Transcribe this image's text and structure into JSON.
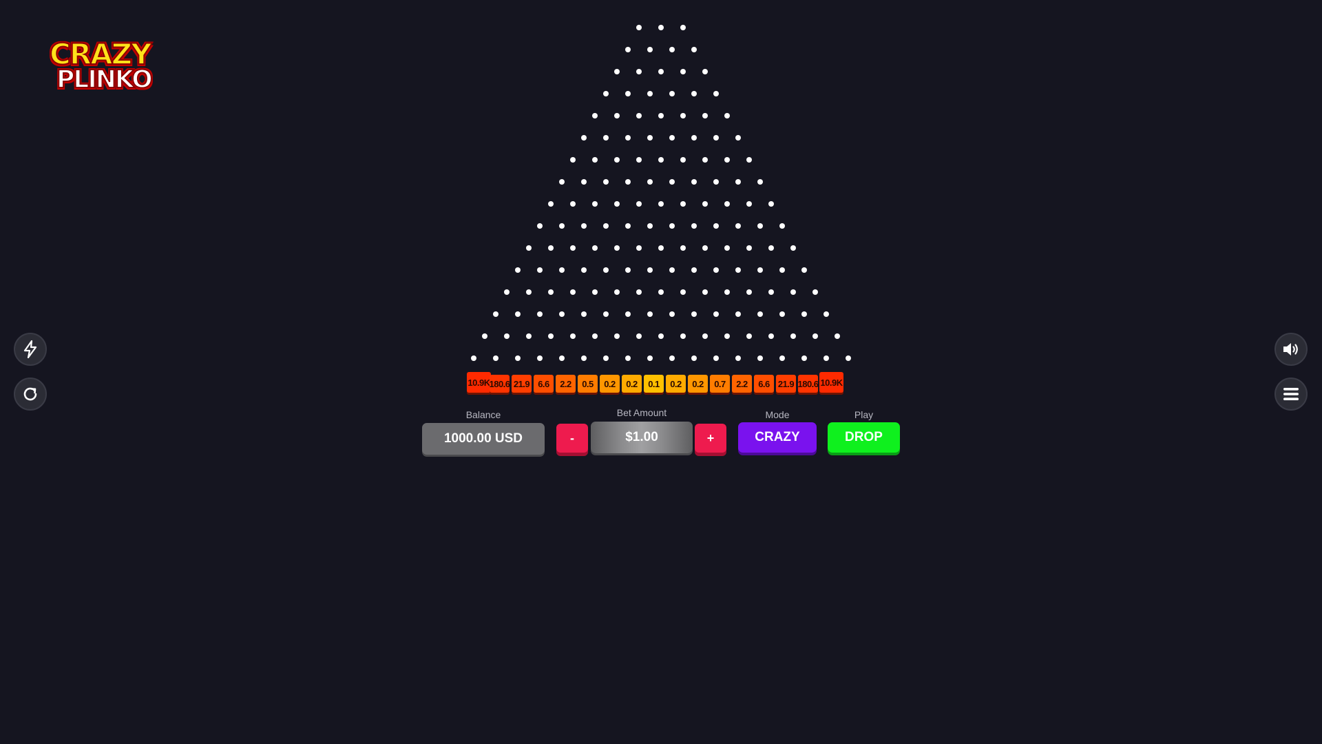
{
  "logo": {
    "line1": "CRAZY",
    "line2": "PLINKO",
    "colors": {
      "top": "#ffe21a",
      "bottom": "#ffffff",
      "outline": "#c40000"
    }
  },
  "side_left": [
    {
      "icon": "lightning-icon"
    },
    {
      "icon": "refresh-icon"
    }
  ],
  "side_right": [
    {
      "icon": "speaker-icon"
    },
    {
      "icon": "hamburger-menu-icon"
    }
  ],
  "board": {
    "rows": 16,
    "top_row_pegs": 3,
    "peg_color": "#ffffff"
  },
  "slots": [
    {
      "label": "10.9K",
      "color": "#ff2a00"
    },
    {
      "label": "180.6",
      "color": "#ff3400"
    },
    {
      "label": "21.9",
      "color": "#ff3e00"
    },
    {
      "label": "6.6",
      "color": "#ff4e00"
    },
    {
      "label": "2.2",
      "color": "#ff6400"
    },
    {
      "label": "0.5",
      "color": "#ff7d00"
    },
    {
      "label": "0.2",
      "color": "#ff9700"
    },
    {
      "label": "0.2",
      "color": "#ffab00"
    },
    {
      "label": "0.1",
      "color": "#ffc000"
    },
    {
      "label": "0.2",
      "color": "#ffab00"
    },
    {
      "label": "0.2",
      "color": "#ff9700"
    },
    {
      "label": "0.7",
      "color": "#ff7d00"
    },
    {
      "label": "2.2",
      "color": "#ff6400"
    },
    {
      "label": "6.6",
      "color": "#ff4e00"
    },
    {
      "label": "21.9",
      "color": "#ff3e00"
    },
    {
      "label": "180.6",
      "color": "#ff3400"
    },
    {
      "label": "10.9K",
      "color": "#ff2a00"
    }
  ],
  "controls": {
    "balance_label": "Balance",
    "balance_value": "1000.00 USD",
    "bet_label": "Bet Amount",
    "bet_value": "$1.00",
    "minus_label": "-",
    "plus_label": "+",
    "mode_label": "Mode",
    "mode_value": "CRAZY",
    "play_label": "Play",
    "play_button": "DROP"
  },
  "colors": {
    "background": "#151520",
    "step_button": "#ee1b4e",
    "mode_button": "#7a12ee",
    "drop_button": "#0ff01e"
  }
}
